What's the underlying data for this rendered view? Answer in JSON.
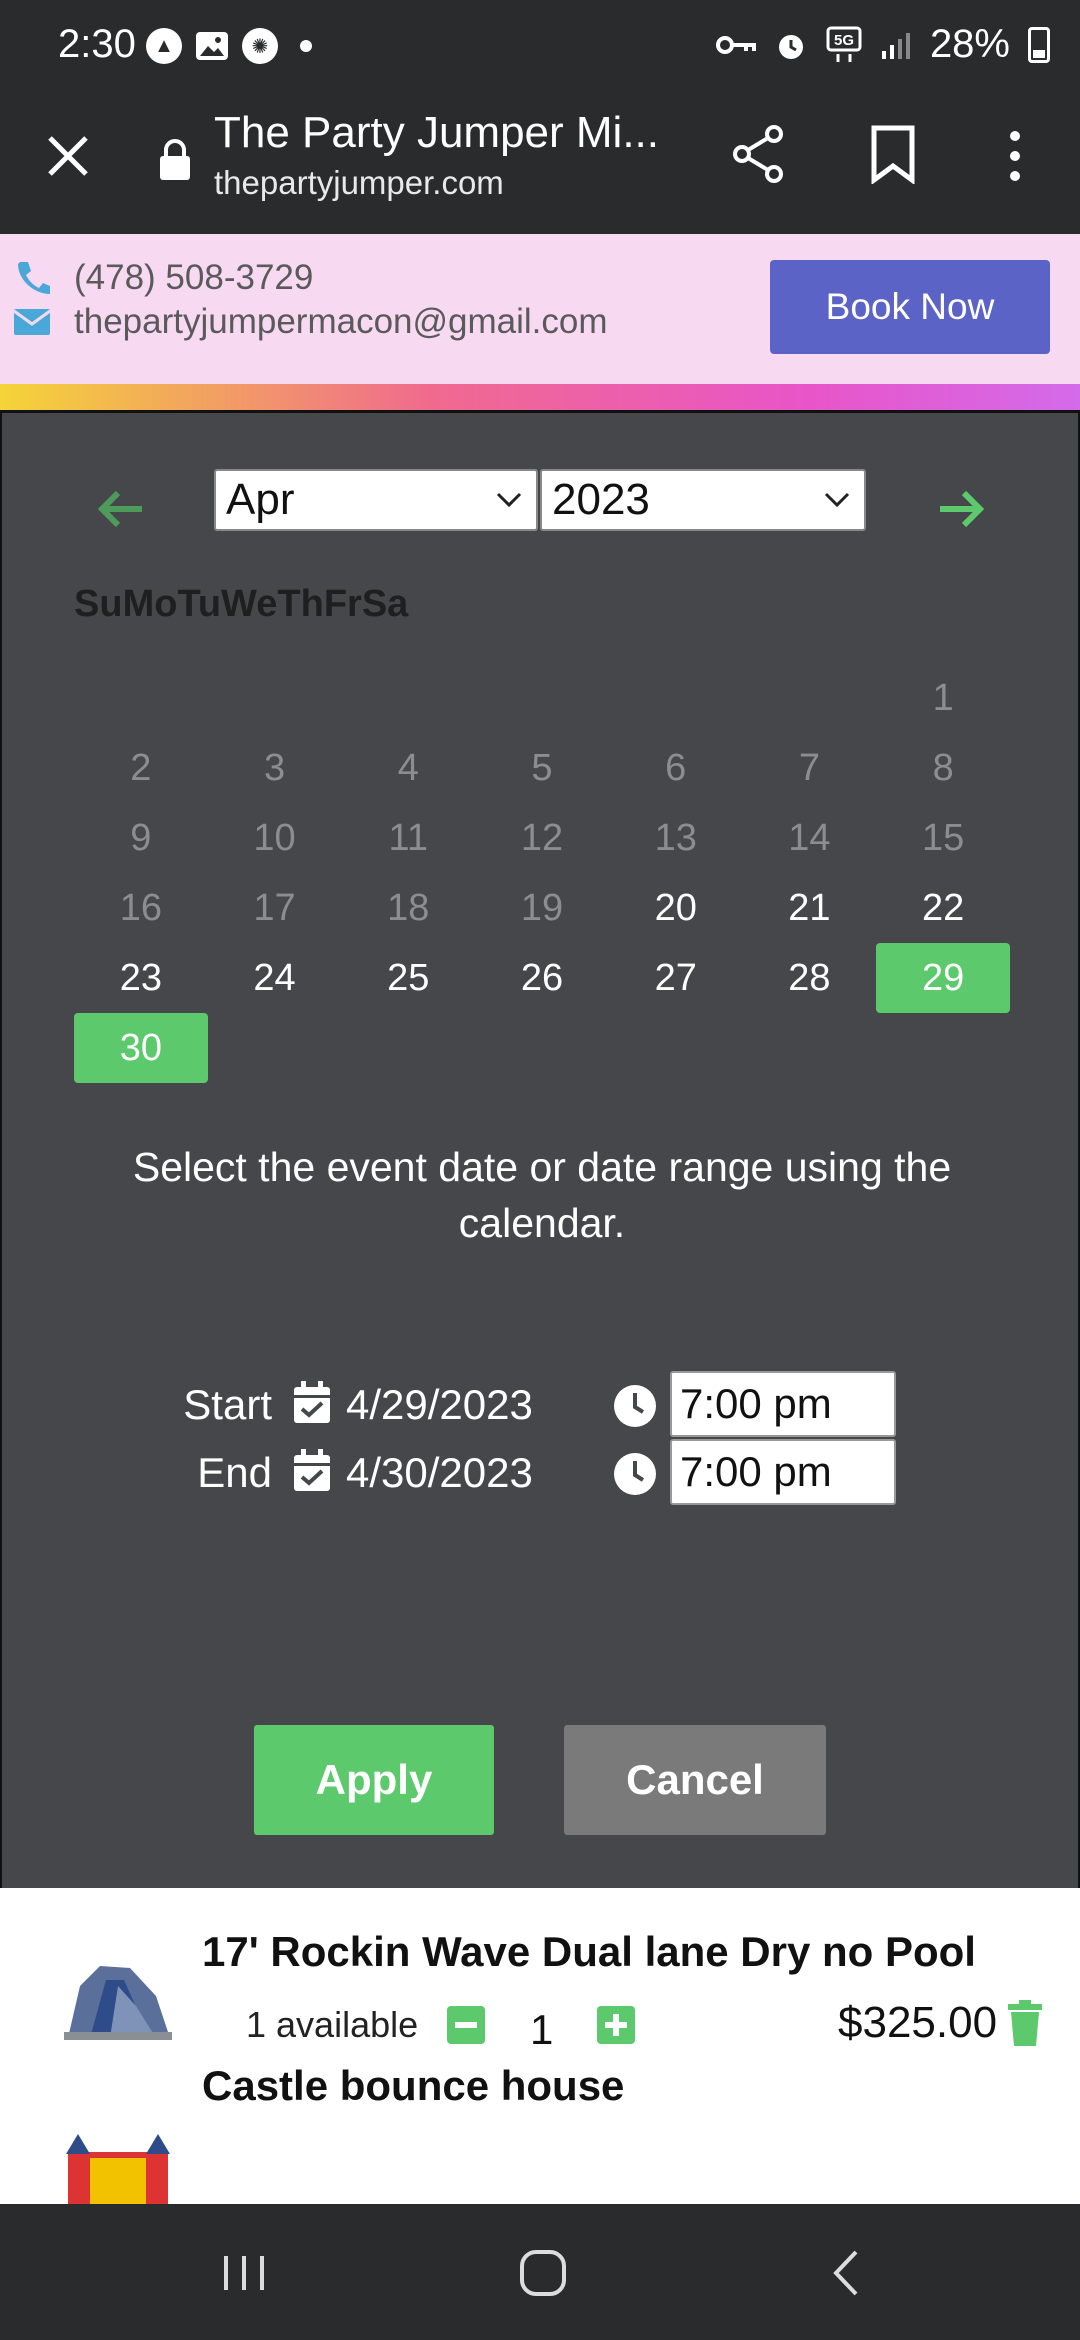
{
  "status_bar": {
    "time": "2:30",
    "battery": "28%",
    "network": "5G"
  },
  "browser": {
    "title": "The Party Jumper Mi...",
    "url": "thepartyjumper.com"
  },
  "header": {
    "phone": "(478) 508-3729",
    "email": "thepartyjumpermacon@gmail.com",
    "book_label": "Book Now"
  },
  "calendar": {
    "month": "Apr",
    "year": "2023",
    "weekdays": [
      "Su",
      "Mo",
      "Tu",
      "We",
      "Th",
      "Fr",
      "Sa"
    ],
    "instructions": "Select the event date or date range using the calendar.",
    "first_weekday_index": 6,
    "days_in_month": 30,
    "first_available_day": 20,
    "selected_days": [
      29,
      30
    ]
  },
  "range": {
    "start_label": "Start",
    "start_date": "4/29/2023",
    "start_time": "7:00 pm",
    "end_label": "End",
    "end_date": "4/30/2023",
    "end_time": "7:00 pm"
  },
  "actions": {
    "apply_label": "Apply",
    "cancel_label": "Cancel"
  },
  "cart": {
    "items": [
      {
        "name": "17' Rockin Wave Dual lane Dry no Pool",
        "availability": "1 available",
        "quantity": "1",
        "price": "$325.00"
      },
      {
        "name": "Castle bounce house"
      }
    ]
  },
  "colors": {
    "accent_green": "#5cc96d",
    "book_button": "#5b63c6",
    "modal_bg": "#45474a",
    "header_bg": "#f8d9f2"
  }
}
